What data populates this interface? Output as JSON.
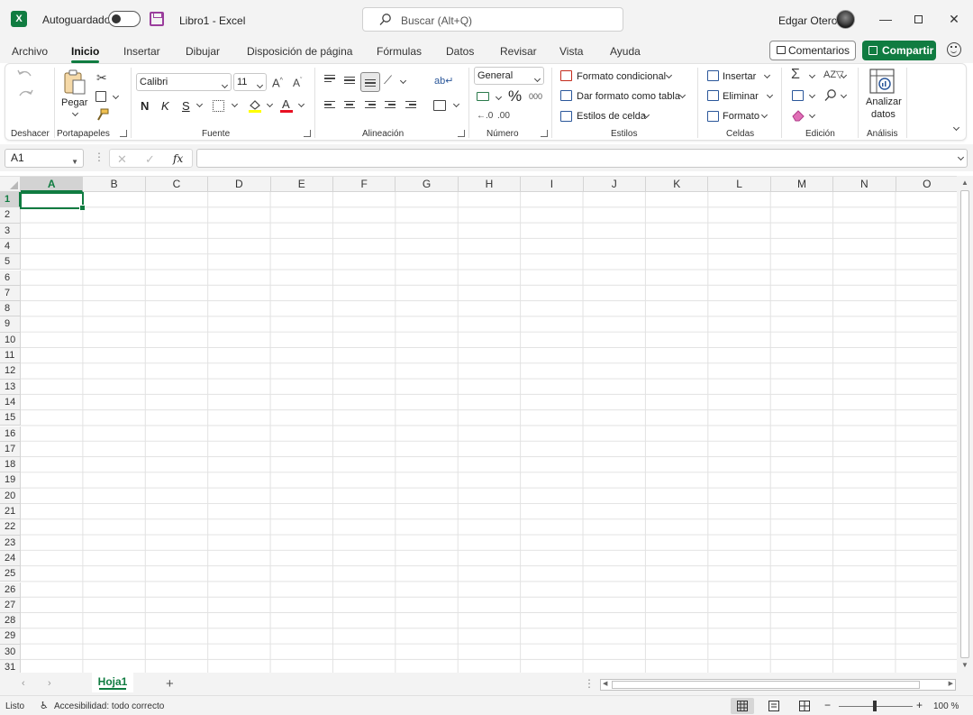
{
  "titlebar": {
    "logo_letter": "X",
    "autosave_label": "Autoguardado",
    "doc_title": "Libro1  -  Excel",
    "search_placeholder": "Buscar (Alt+Q)",
    "user_name": "Edgar Otero"
  },
  "tabs": [
    "Archivo",
    "Inicio",
    "Insertar",
    "Dibujar",
    "Disposición de página",
    "Fórmulas",
    "Datos",
    "Revisar",
    "Vista",
    "Ayuda"
  ],
  "active_tab": "Inicio",
  "actions": {
    "comments_label": "Comentarios",
    "share_label": "Compartir"
  },
  "ribbon": {
    "groups": {
      "undo": "Deshacer",
      "clipboard": "Portapapeles",
      "font": "Fuente",
      "alignment": "Alineación",
      "number": "Número",
      "styles": "Estilos",
      "cells": "Celdas",
      "editing": "Edición",
      "analysis": "Análisis"
    },
    "paste_label": "Pegar",
    "font_name": "Calibri",
    "font_size": "11",
    "bold": "N",
    "italic": "K",
    "underline": "S",
    "number_format": "General",
    "conditional_format": "Formato condicional",
    "format_as_table": "Dar formato como tabla",
    "cell_styles": "Estilos de celda",
    "insert": "Insertar",
    "delete": "Eliminar",
    "format": "Formato",
    "analyze_data_line1": "Analizar",
    "analyze_data_line2": "datos",
    "percent": "%",
    "thousands": "000"
  },
  "formula_bar": {
    "name_box": "A1",
    "fx": "fx",
    "content": ""
  },
  "grid": {
    "columns": [
      "A",
      "B",
      "C",
      "D",
      "E",
      "F",
      "G",
      "H",
      "I",
      "J",
      "K",
      "L",
      "M",
      "N",
      "O"
    ],
    "rows": [
      "1",
      "2",
      "3",
      "4",
      "5",
      "6",
      "7",
      "8",
      "9",
      "10",
      "11",
      "12",
      "13",
      "14",
      "15",
      "16",
      "17",
      "18",
      "19",
      "20",
      "21",
      "22",
      "23",
      "24",
      "25",
      "26",
      "27",
      "28",
      "29",
      "30",
      "31"
    ],
    "selected_cell": "A1"
  },
  "sheets": [
    "Hoja1"
  ],
  "statusbar": {
    "ready": "Listo",
    "accessibility": "Accesibilidad: todo correcto",
    "zoom": "100 %"
  },
  "colors": {
    "accent": "#107c41",
    "titlebar_bg": "#f3f3f3"
  }
}
